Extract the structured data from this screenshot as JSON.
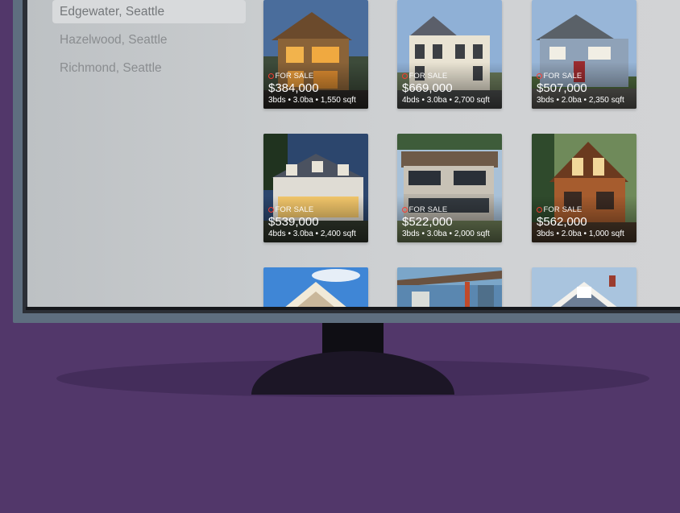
{
  "sidebar": {
    "items": [
      {
        "label": "Edgewater, Seattle",
        "selected": true
      },
      {
        "label": "Hazelwood, Seattle",
        "selected": false
      },
      {
        "label": "Richmond, Seattle",
        "selected": false
      }
    ]
  },
  "listings": [
    {
      "status": "FOR SALE",
      "price": "$384,000",
      "specs": "3bds • 3.0ba • 1,550 sqft"
    },
    {
      "status": "FOR SALE",
      "price": "$669,000",
      "specs": "4bds • 3.0ba • 2,700 sqft"
    },
    {
      "status": "FOR SALE",
      "price": "$507,000",
      "specs": "3bds • 2.0ba • 2,350 sqft"
    },
    {
      "status": "FOR SALE",
      "price": "$539,000",
      "specs": "4bds • 3.0ba • 2,400 sqft"
    },
    {
      "status": "FOR SALE",
      "price": "$522,000",
      "specs": "3bds • 3.0ba • 2,000 sqft"
    },
    {
      "status": "FOR SALE",
      "price": "$562,000",
      "specs": "3bds • 2.0ba • 1,000 sqft"
    },
    {
      "status": "",
      "price": "",
      "specs": ""
    },
    {
      "status": "",
      "price": "",
      "specs": ""
    },
    {
      "status": "",
      "price": "",
      "specs": ""
    }
  ],
  "colors": {
    "background": "#52376a",
    "status_dot": "#ff3b30"
  }
}
